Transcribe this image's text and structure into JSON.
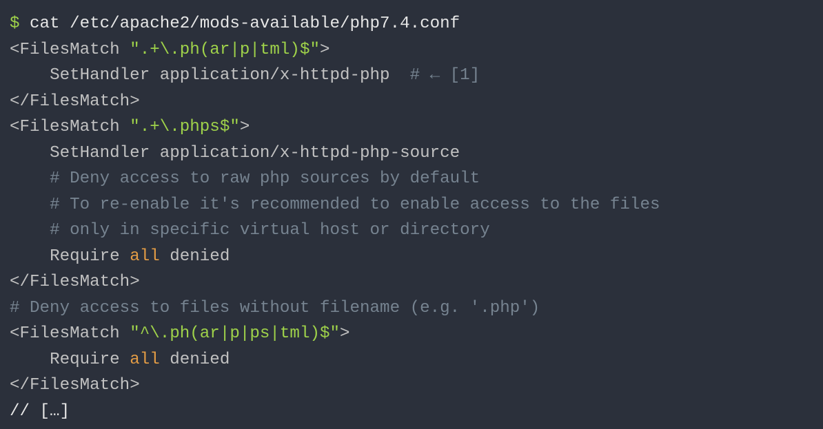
{
  "lines": {
    "l1": {
      "prompt": "$ ",
      "cmd": "cat /etc/apache2/mods-available/php7.4.conf"
    },
    "l2": {
      "open": "<",
      "tag": "FilesMatch",
      "sp": " ",
      "str": "\".+\\.ph(ar|p|tml)$\"",
      "close": ">"
    },
    "l3": {
      "indent": "    ",
      "dir": "SetHandler application/x-httpd-php",
      "pad": "  ",
      "cm": "# ← [1]"
    },
    "l4": {
      "open": "</",
      "tag": "FilesMatch",
      "close": ">"
    },
    "l5": {
      "open": "<",
      "tag": "FilesMatch",
      "sp": " ",
      "str": "\".+\\.phps$\"",
      "close": ">"
    },
    "l6": {
      "indent": "    ",
      "dir": "SetHandler application/x-httpd-php-source"
    },
    "l7": {
      "indent": "    ",
      "cm": "# Deny access to raw php sources by default"
    },
    "l8": {
      "indent": "    ",
      "cm": "# To re-enable it's recommended to enable access to the files"
    },
    "l9": {
      "indent": "    ",
      "cm": "# only in specific virtual host or directory"
    },
    "l10": {
      "indent": "    ",
      "req": "Require ",
      "all": "all",
      "deny": " denied"
    },
    "l11": {
      "open": "</",
      "tag": "FilesMatch",
      "close": ">"
    },
    "l12": {
      "cm": "# Deny access to files without filename (e.g. '.php')"
    },
    "l13": {
      "open": "<",
      "tag": "FilesMatch",
      "sp": " ",
      "str": "\"^\\.ph(ar|p|ps|tml)$\"",
      "close": ">"
    },
    "l14": {
      "indent": "    ",
      "req": "Require ",
      "all": "all",
      "deny": " denied"
    },
    "l15": {
      "open": "</",
      "tag": "FilesMatch",
      "close": ">"
    },
    "l16": {
      "txt": "// […]"
    }
  }
}
